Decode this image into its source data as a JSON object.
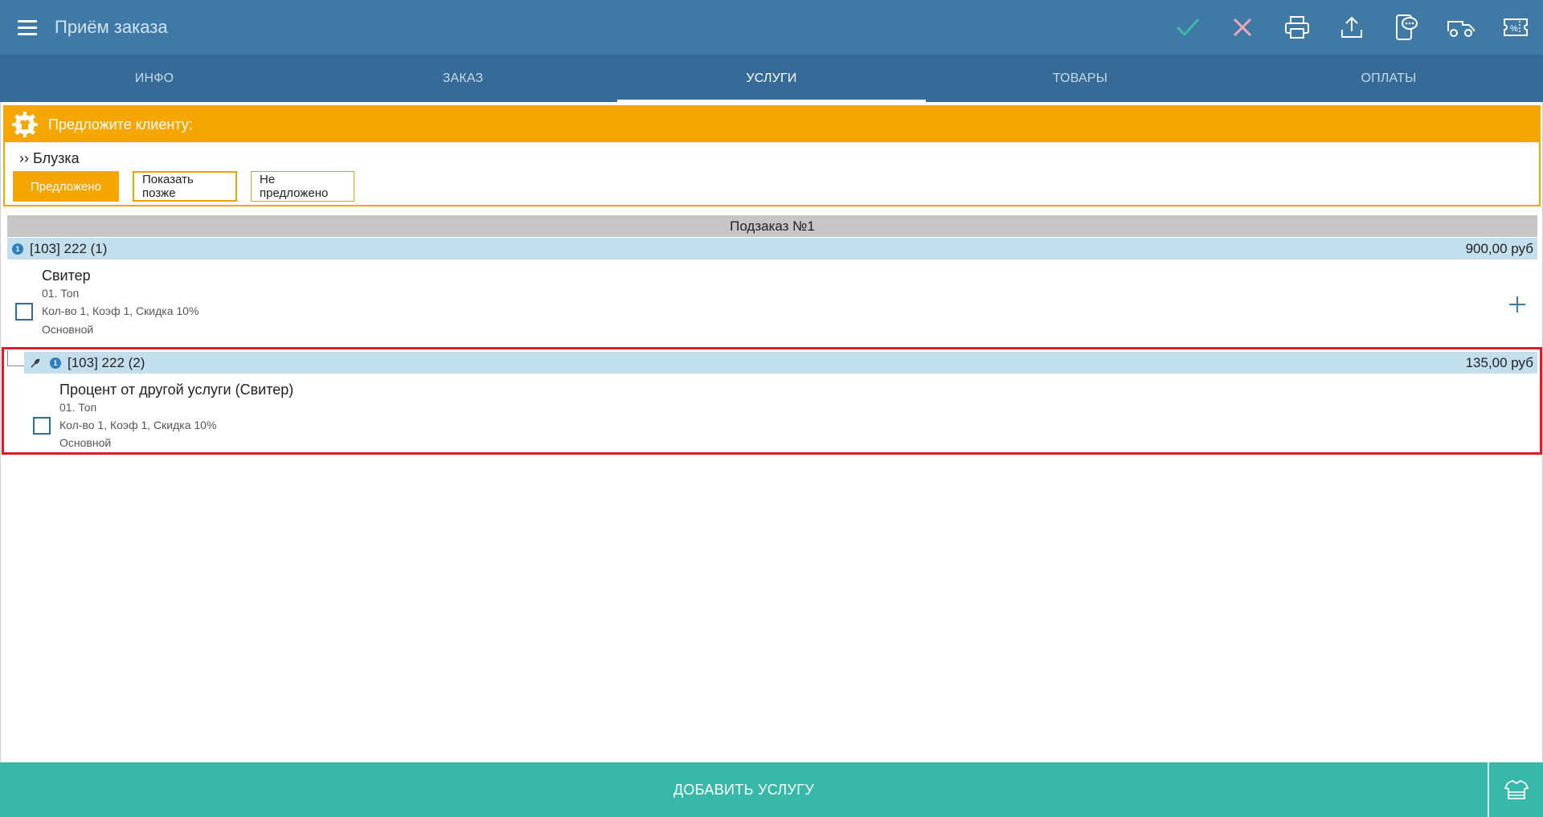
{
  "header": {
    "title": "Приём заказа",
    "icons": [
      "menu-icon",
      "check-icon",
      "close-icon",
      "print-icon",
      "upload-icon",
      "phone-message-icon",
      "delivery-car-icon",
      "discount-ticket-icon"
    ]
  },
  "tabs": [
    {
      "label": "ИНФО",
      "active": false
    },
    {
      "label": "ЗАКАЗ",
      "active": false
    },
    {
      "label": "УСЛУГИ",
      "active": true
    },
    {
      "label": "ТОВАРЫ",
      "active": false
    },
    {
      "label": "ОПЛАТЫ",
      "active": false
    }
  ],
  "suggestion": {
    "title": "Предложите клиенту:",
    "item": "›› Блузка",
    "buttons": {
      "offered": "Предложено",
      "show_later": "Показать позже",
      "not_offered": "Не предложено"
    }
  },
  "suborder": {
    "title": "Подзаказ №1",
    "groups": [
      {
        "code": "[103] 222 (1)",
        "price": "900,00 руб",
        "info": "1",
        "service": {
          "name": "Свитер",
          "category": "01. Топ",
          "details": "Кол-во 1, Коэф 1, Скидка 10%",
          "type": "Основной"
        }
      },
      {
        "code": "[103] 222 (2)",
        "price": "135,00 руб",
        "info": "1",
        "service": {
          "name": "Процент от другой услуги (Свитер)",
          "category": "01. Топ",
          "details": "Кол-во 1, Коэф 1, Скидка 10%",
          "type": "Основной"
        }
      }
    ]
  },
  "footer": {
    "add_label": "ДОБАВИТЬ УСЛУГУ"
  },
  "colors": {
    "header": "#3f7aa6",
    "tabs": "#356b96",
    "accent": "#f6a600",
    "footer": "#37b8a8",
    "group_row": "#c3dfee",
    "highlight": "#e01b24"
  }
}
